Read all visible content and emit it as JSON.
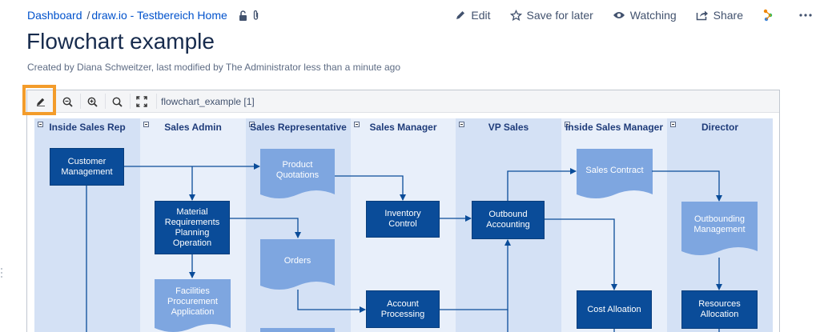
{
  "breadcrumb": {
    "items": [
      "Dashboard",
      "draw.io - Testbereich Home"
    ],
    "separator": "/"
  },
  "actions": {
    "edit": "Edit",
    "save": "Save for later",
    "watch": "Watching",
    "share": "Share"
  },
  "page": {
    "title": "Flowchart example",
    "byline": "Created by Diana Schweitzer, last modified by The Administrator less than a minute ago"
  },
  "viewer": {
    "diagram_name": "flowchart_example [1]"
  },
  "lanes": [
    {
      "label": "Inside Sales Rep"
    },
    {
      "label": "Sales Admin"
    },
    {
      "label": "Sales Representative"
    },
    {
      "label": "Sales Manager"
    },
    {
      "label": "VP Sales"
    },
    {
      "label": "Inside Sales Manager"
    },
    {
      "label": "Director"
    }
  ],
  "nodes": {
    "customer_management": "Customer\nManagement",
    "product_quotations": "Product\nQuotations",
    "sales_contract": "Sales Contract",
    "material_requirements": "Material\nRequirements\nPlanning\nOperation",
    "inventory_control": "Inventory\nControl",
    "outbound_accounting": "Outbound\nAccounting",
    "outbounding_management": "Outbounding\nManagement",
    "orders": "Orders",
    "facilities_procurement": "Facilities\nProcurement\nApplication",
    "account_processing": "Account\nProcessing",
    "cost_alloation": "Cost Alloation",
    "resources_allocation": "Resources\nAllocation"
  },
  "colors": {
    "link": "#0052cc",
    "highlight": "#f39c2b",
    "dark_node": "#0a4c99",
    "light_node": "#7ea6e0",
    "lane_a": "#d4e1f5",
    "lane_b": "#e8effa",
    "arrow": "#0a4c99"
  }
}
